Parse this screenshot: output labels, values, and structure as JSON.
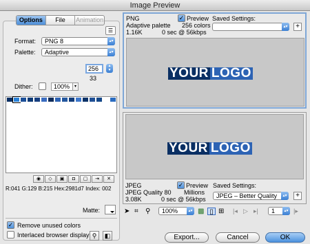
{
  "window": {
    "title": "Image Preview"
  },
  "tabs": [
    {
      "label": "Options",
      "state": "active"
    },
    {
      "label": "File",
      "state": "normal"
    },
    {
      "label": "Animation",
      "state": "disabled"
    }
  ],
  "options": {
    "format_label": "Format:",
    "format_value": "PNG 8",
    "palette_label": "Palette:",
    "palette_value": "Adaptive",
    "max_colors": "256",
    "color_count": "33",
    "dither_label": "Dither:",
    "dither_amount": "100%",
    "color_info": "R:041 G:129 B:215 Hex:2981d7 Index: 002",
    "matte_label": "Matte:",
    "remove_unused_label": "Remove unused colors",
    "remove_unused_checked": true,
    "interlaced_label": "Interlaced browser display",
    "interlaced_checked": false
  },
  "palette_colors": [
    "#0a2f63",
    "#2981d7",
    "#1c4f98",
    "#0d3a76",
    "#173f80",
    "#3a6cc0",
    "#0f2c5a",
    "#2d63b4",
    "#24579f",
    "#113c7b",
    "#3e78cc",
    "#0b3268",
    "#1f4f95",
    "#154889",
    "#ffffff",
    "#2b6cc0"
  ],
  "top_pane": {
    "format": "PNG",
    "palette": "Adaptive palette",
    "size": "1.16K",
    "preview_label": "Preview",
    "preview_checked": true,
    "colors": "256 colors",
    "speed": "0 sec @ 56kbps",
    "saved_settings_label": "Saved Settings:",
    "saved_settings_value": ""
  },
  "bottom_pane": {
    "format": "JPEG",
    "quality": "JPEG Quality 80",
    "size": "3.08K",
    "preview_label": "Preview",
    "preview_checked": true,
    "colors": "Millions",
    "speed": "0 sec @ 56kbps",
    "saved_settings_label": "Saved Settings:",
    "saved_settings_value": "JPEG – Better Quality"
  },
  "logo": {
    "part1": "YOUR",
    "part2": "LOGO"
  },
  "toolbar": {
    "zoom": "100%",
    "page": "1"
  },
  "buttons": {
    "export": "Export...",
    "cancel": "Cancel",
    "ok": "OK"
  },
  "colors": {
    "accent": "#4d8fd9",
    "logo_dark": "#0a2f63",
    "logo_light": "#2d63b4",
    "preview_bg": "#c8c8c8"
  },
  "icons": {
    "add": "+",
    "menu": "menu-lines-icon"
  }
}
